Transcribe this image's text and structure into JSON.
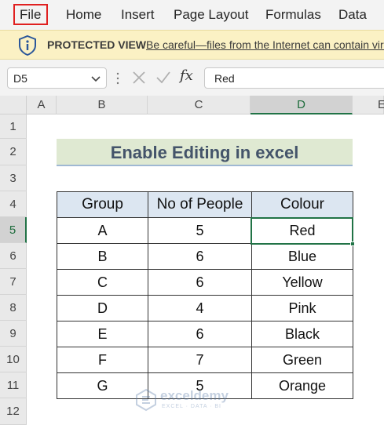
{
  "menu": {
    "items": [
      "File",
      "Home",
      "Insert",
      "Page Layout",
      "Formulas",
      "Data"
    ]
  },
  "protected_view": {
    "title": "PROTECTED VIEW",
    "message": "Be careful—files from the Internet can contain viruses. Unless you need to edit, it's safer to stay in Protected View.",
    "icon": "shield-info-icon"
  },
  "formula_bar": {
    "name_box": "D5",
    "formula": "Red",
    "fx_label": "fx"
  },
  "columns": [
    "A",
    "B",
    "C",
    "D",
    "E"
  ],
  "rows": [
    "1",
    "2",
    "3",
    "4",
    "5",
    "6",
    "7",
    "8",
    "9",
    "10",
    "11",
    "12"
  ],
  "sheet": {
    "title": "Enable Editing in excel",
    "headers": [
      "Group",
      "No of People",
      "Colour"
    ],
    "data": [
      [
        "A",
        "5",
        "Red"
      ],
      [
        "B",
        "6",
        "Blue"
      ],
      [
        "C",
        "6",
        "Yellow"
      ],
      [
        "D",
        "4",
        "Pink"
      ],
      [
        "E",
        "6",
        "Black"
      ],
      [
        "F",
        "7",
        "Green"
      ],
      [
        "G",
        "5",
        "Orange"
      ]
    ]
  },
  "watermark": {
    "name": "exceldemy",
    "sub": "EXCEL · DATA · BI"
  },
  "colors": {
    "accent": "#217346",
    "highlight_box": "#e02020",
    "protected_bg": "#fbf1c4",
    "title_bg": "#dfe9d2",
    "header_bg": "#dce6f1"
  }
}
